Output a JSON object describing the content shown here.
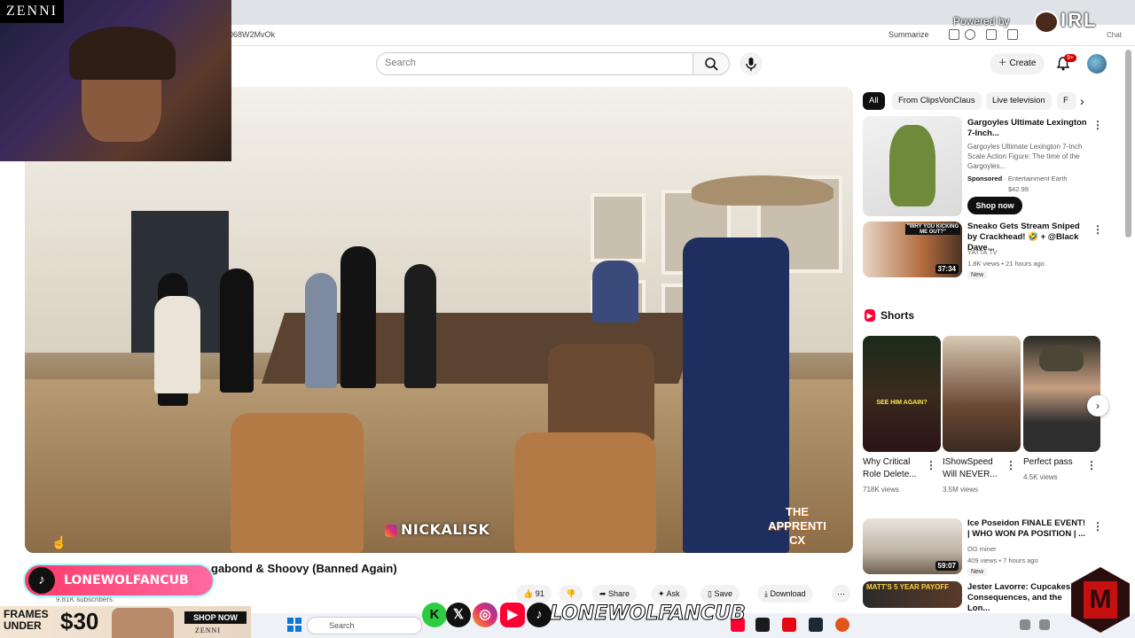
{
  "browser": {
    "url": "068W2MvOk",
    "summarize_label": "Summarize",
    "chat_label": "Chat"
  },
  "header": {
    "search_placeholder": "Search",
    "create_label": "Create",
    "notification_count": "9+"
  },
  "video": {
    "watermark": "NICKALISK",
    "logo_text_1": "THE",
    "logo_text_2": "APPRENTI",
    "logo_text_3": "CX",
    "title": "gabond & Shoovy (Banned Again)",
    "subscribers": "9.81K subscribers",
    "actions": {
      "likes": "91",
      "share": "Share",
      "ask": "Ask",
      "save": "Save",
      "download": "Download"
    }
  },
  "chips": [
    "All",
    "From ClipsVonClaus",
    "Live television",
    "F"
  ],
  "ad": {
    "title": "Gargoyles Ultimate Lexington 7-Inch...",
    "desc": "Gargoyles Ultimate Lexington 7-Inch Scale Action Figure: The time of the Gargoyles...",
    "sponsored": "Sponsored",
    "advertiser": "Entertainment Earth",
    "price": "$42.99",
    "cta": "Shop now"
  },
  "recommendations": [
    {
      "title": "Sneako Gets Stream Sniped by Crackhead! 🤣 + @Black Dave...",
      "channel": "YATTA TV",
      "meta": "1.8K views • 21 hours ago",
      "badge": "New",
      "duration": "37:34",
      "thumb_text": "\"WHY YOU KICKING ME OUT?\""
    },
    {
      "title": "Ice Poseidon FINALE EVENT! | WHO WON PA POSITION | ...",
      "channel": "OG miner",
      "meta": "409 views • 7 hours ago",
      "badge": "New",
      "duration": "59:07"
    },
    {
      "title": "Jester Lavorre: Cupcakes, Consequences, and the Lon...",
      "thumb_text": "MATT'S 5 YEAR PAYOFF"
    }
  ],
  "shorts": {
    "heading": "Shorts",
    "items": [
      {
        "title": "Why Critical Role Delete...",
        "views": "718K views",
        "thumb_text": "SEE HIM AGAIN?"
      },
      {
        "title": "IShowSpeed Will NEVER...",
        "views": "3.5M views"
      },
      {
        "title": "Perfect pass",
        "views": "4.5K views"
      }
    ]
  },
  "overlay": {
    "zenni": "ZENNI",
    "powered_by": "Powered by",
    "irl": "IRL",
    "tiktok_handle": "LONEWOLFANCUB",
    "social_handle": "LONEWOLFANCUB",
    "ad_frames_line1": "FRAMES",
    "ad_frames_line2": "UNDER",
    "ad_price": "$30",
    "ad_shop": "SHOP NOW",
    "ad_brand": "ZENNI"
  },
  "taskbar": {
    "search_placeholder": "Search"
  },
  "colors": {
    "youtube_red": "#ff0033",
    "tiktok_pink": "#ff3b6b",
    "windows_blue": "#0a78d4"
  }
}
